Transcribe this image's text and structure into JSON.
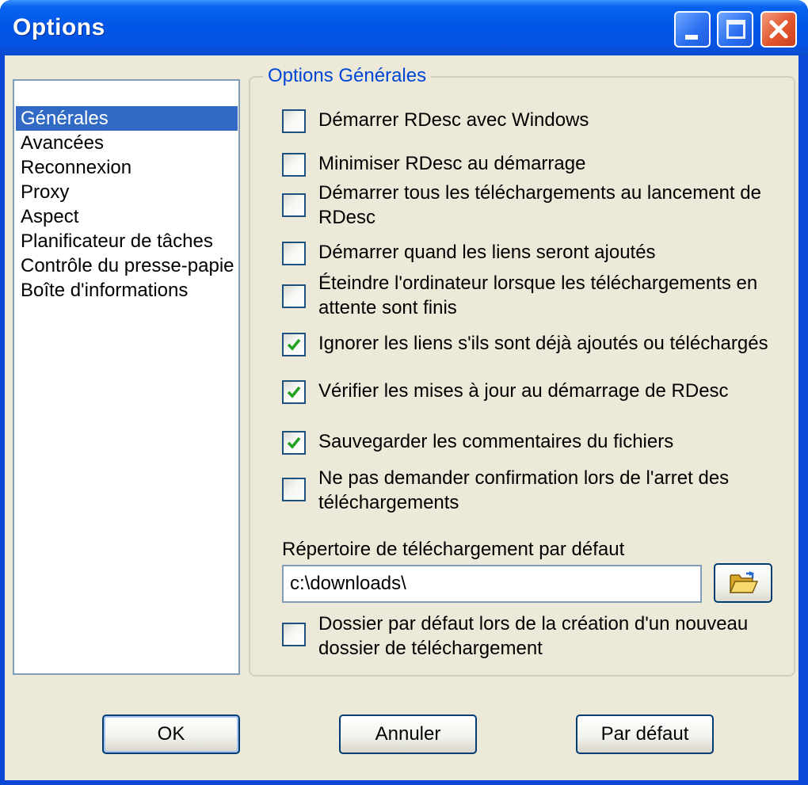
{
  "window": {
    "title": "Options"
  },
  "titlebar_buttons": {
    "minimize_icon": "minimize-icon",
    "maximize_icon": "maximize-icon",
    "close_icon": "close-icon",
    "close_color": "#e2572e"
  },
  "sidebar": {
    "items": [
      {
        "label": "Générales",
        "selected": true
      },
      {
        "label": "Avancées",
        "selected": false
      },
      {
        "label": "Reconnexion",
        "selected": false
      },
      {
        "label": "Proxy",
        "selected": false
      },
      {
        "label": "Aspect",
        "selected": false
      },
      {
        "label": "Planificateur de tâches",
        "selected": false
      },
      {
        "label": "Contrôle du presse-papie",
        "selected": false
      },
      {
        "label": "Boîte d'informations",
        "selected": false
      }
    ],
    "selection_color": "#316ac5"
  },
  "general_group": {
    "legend": "Options Générales",
    "legend_color": "#0046d5",
    "options": [
      {
        "label": "Démarrer RDesc avec Windows",
        "checked": false
      },
      {
        "label": "Minimiser RDesc au démarrage",
        "checked": false
      },
      {
        "label": "Démarrer tous les téléchargements au lancement de RDesc",
        "checked": false
      },
      {
        "label": "Démarrer quand les liens seront ajoutés",
        "checked": false
      },
      {
        "label": "Éteindre l'ordinateur lorsque les téléchargements en attente sont finis",
        "checked": false
      },
      {
        "label": "Ignorer les liens s'ils sont déjà ajoutés ou téléchargés",
        "checked": true
      },
      {
        "label": "Vérifier les mises à jour au démarrage de RDesc",
        "checked": true
      },
      {
        "label": "Sauvegarder les commentaires du fichiers",
        "checked": true
      },
      {
        "label": "Ne pas demander confirmation lors de l'arret des téléchargements",
        "checked": false
      }
    ],
    "download_dir": {
      "label": "Répertoire de téléchargement par défaut",
      "value": "c:\\downloads\\",
      "browse_icon": "open-folder-icon"
    },
    "folder_option": {
      "label": "Dossier par défaut lors de la création d'un nouveau dossier de téléchargement",
      "checked": false
    },
    "check_color": "#21a121"
  },
  "buttons": {
    "ok": "OK",
    "cancel": "Annuler",
    "default": "Par défaut"
  }
}
